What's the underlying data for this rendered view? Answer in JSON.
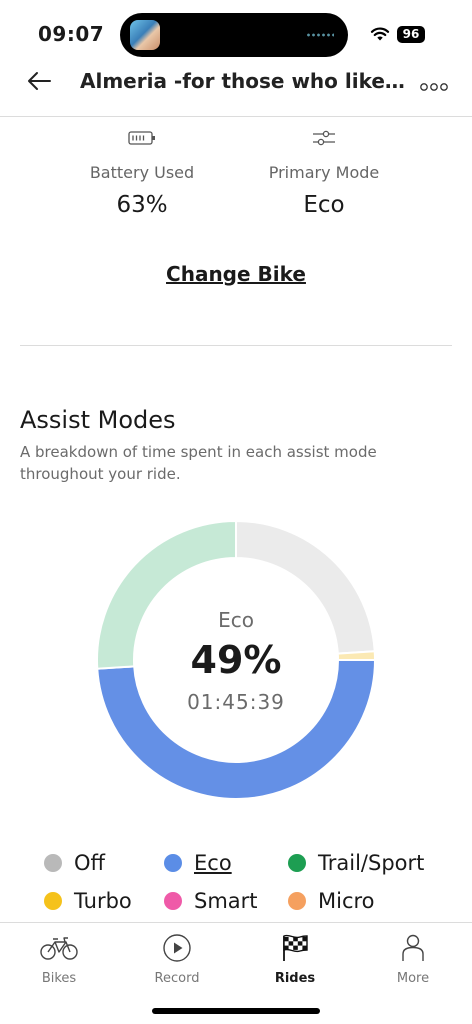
{
  "status_bar": {
    "time": "09:07",
    "battery_level": "96"
  },
  "header": {
    "title": "Almeria -for those who like th..."
  },
  "stats": {
    "battery": {
      "label": "Battery Used",
      "value": "63%",
      "icon": "battery-icon"
    },
    "mode": {
      "label": "Primary Mode",
      "value": "Eco",
      "icon": "sliders-icon"
    }
  },
  "change_bike_label": "Change Bike",
  "assist_modes": {
    "title": "Assist Modes",
    "description": "A breakdown of time spent in each assist mode throughout your ride."
  },
  "chart_data": {
    "type": "pie",
    "style": "donut",
    "slices": [
      {
        "name": "Off",
        "percent": 24,
        "color": "#ebebeb"
      },
      {
        "name": "Turbo",
        "percent": 1,
        "color": "#fbe9b4"
      },
      {
        "name": "Eco",
        "percent": 49,
        "color": "#6490e6"
      },
      {
        "name": "Trail/Sport",
        "percent": 26,
        "color": "#c6e9d6"
      }
    ],
    "center": {
      "mode": "Eco",
      "percent_label": "49%",
      "time": "01:45:39"
    }
  },
  "legend": [
    {
      "label": "Off",
      "color": "#b9b9b9",
      "active": false
    },
    {
      "label": "Eco",
      "color": "#5b8de6",
      "active": true
    },
    {
      "label": "Trail/Sport",
      "color": "#1d9e52",
      "active": false
    },
    {
      "label": "Turbo",
      "color": "#f5c21b",
      "active": false
    },
    {
      "label": "Smart",
      "color": "#ef5aa8",
      "active": false
    },
    {
      "label": "Micro",
      "color": "#f5a05f",
      "active": false
    }
  ],
  "tabs": [
    {
      "label": "Bikes",
      "icon": "bike-icon",
      "active": false
    },
    {
      "label": "Record",
      "icon": "play-icon",
      "active": false
    },
    {
      "label": "Rides",
      "icon": "checkered-flag-icon",
      "active": true
    },
    {
      "label": "More",
      "icon": "person-icon",
      "active": false
    }
  ]
}
